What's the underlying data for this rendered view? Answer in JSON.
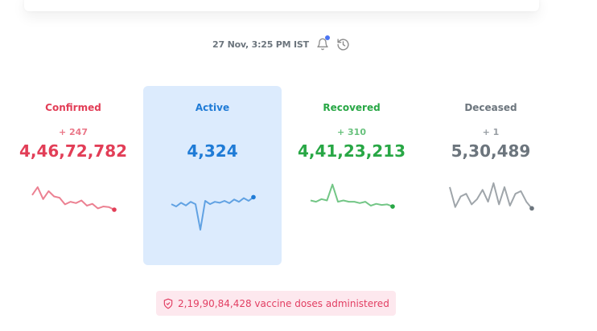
{
  "header": {
    "timestamp": "27 Nov, 3:25 PM IST",
    "notification_icon": "bell-icon",
    "history_icon": "history-icon",
    "notification_dot_color": "#4c75f2"
  },
  "stats": [
    {
      "key": "confirmed",
      "label": "Confirmed",
      "delta": "+ 247",
      "value": "4,46,72,782",
      "color": "#e23e57",
      "trend": [
        0.55,
        0.85,
        0.4,
        0.7,
        0.5,
        0.45,
        0.2,
        0.3,
        0.25,
        0.35,
        0.15,
        0.22,
        0.05,
        0.12,
        0.1,
        0.0
      ]
    },
    {
      "key": "active",
      "label": "Active",
      "delta": "",
      "value": "4,324",
      "color": "#1f7bd6",
      "trend": [
        0.55,
        0.5,
        0.58,
        0.52,
        0.6,
        0.55,
        0.0,
        0.62,
        0.55,
        0.6,
        0.58,
        0.62,
        0.57,
        0.65,
        0.6,
        0.68,
        0.62,
        0.7
      ]
    },
    {
      "key": "recovered",
      "label": "Recovered",
      "delta": "+ 310",
      "value": "4,41,23,213",
      "color": "#28a745",
      "trend": [
        0.35,
        0.3,
        0.4,
        0.35,
        0.95,
        0.3,
        0.35,
        0.3,
        0.3,
        0.25,
        0.3,
        0.15,
        0.22,
        0.18,
        0.2,
        0.12
      ]
    },
    {
      "key": "deceased",
      "label": "Deceased",
      "delta": "+ 1",
      "value": "5,30,489",
      "color": "#6c757d",
      "trend": [
        0.85,
        0.1,
        0.5,
        0.6,
        0.2,
        0.4,
        0.75,
        0.3,
        1.0,
        0.2,
        0.85,
        0.15,
        0.6,
        0.7,
        0.3,
        0.05
      ]
    }
  ],
  "vaccine": {
    "text": "2,19,90,84,428 vaccine doses administered",
    "icon": "shield-check-icon",
    "color": "#e23e62"
  }
}
